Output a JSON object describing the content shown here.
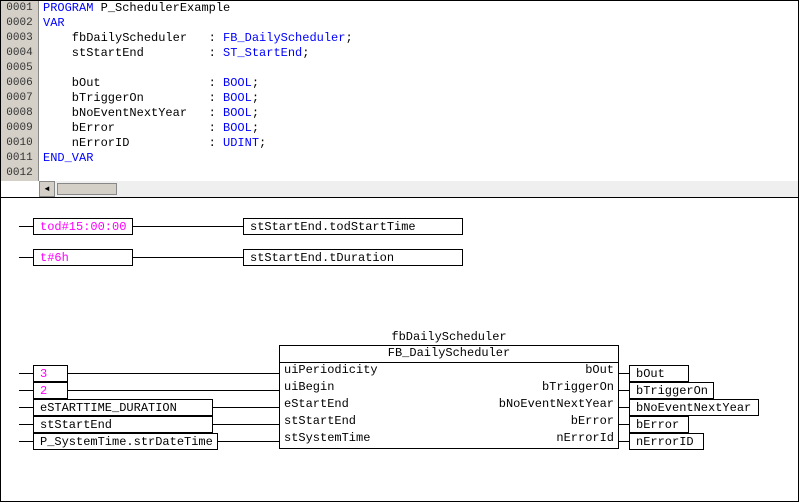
{
  "code": {
    "lines": [
      {
        "n": "0001",
        "pre": "",
        "kw": "PROGRAM",
        "rest": " P_SchedulerExample"
      },
      {
        "n": "0002",
        "pre": "",
        "kw": "VAR",
        "rest": ""
      },
      {
        "n": "0003",
        "pre": "    ",
        "name": "fbDailyScheduler",
        "colpad": "   ",
        "type": "FB_DailyScheduler"
      },
      {
        "n": "0004",
        "pre": "    ",
        "name": "stStartEnd",
        "colpad": "         ",
        "type": "ST_StartEnd"
      },
      {
        "n": "0005",
        "blank": true
      },
      {
        "n": "0006",
        "pre": "    ",
        "name": "bOut",
        "colpad": "               ",
        "type": "BOOL"
      },
      {
        "n": "0007",
        "pre": "    ",
        "name": "bTriggerOn",
        "colpad": "         ",
        "type": "BOOL"
      },
      {
        "n": "0008",
        "pre": "    ",
        "name": "bNoEventNextYear",
        "colpad": "   ",
        "type": "BOOL"
      },
      {
        "n": "0009",
        "pre": "    ",
        "name": "bError",
        "colpad": "             ",
        "type": "BOOL"
      },
      {
        "n": "0010",
        "pre": "    ",
        "name": "nErrorID",
        "colpad": "           ",
        "type": "UDINT"
      },
      {
        "n": "0011",
        "pre": "",
        "kw": "END_VAR",
        "rest": ""
      },
      {
        "n": "0012",
        "blank": true
      }
    ]
  },
  "assign": [
    {
      "lit": "tod#15:00:00",
      "target": "stStartEnd.todStartTime",
      "lw": 100,
      "ww": 110,
      "tw": 220
    },
    {
      "lit": "t#6h",
      "target": "stStartEnd.tDuration",
      "lw": 100,
      "ww": 110,
      "tw": 220
    }
  ],
  "fb": {
    "instance": "fbDailyScheduler",
    "type": "FB_DailyScheduler",
    "inputs": [
      "uiPeriodicity",
      "uiBegin",
      "eStartEnd",
      "stStartEnd",
      "stSystemTime"
    ],
    "outputs": [
      "bOut",
      "bTriggerOn",
      "bNoEventNextYear",
      "bError",
      "nErrorId"
    ],
    "leftvals": [
      "3",
      "2",
      "eSTARTTIME_DURATION",
      "stStartEnd",
      "P_SystemTime.strDateTime"
    ],
    "leftw": [
      35,
      35,
      180,
      180,
      185
    ],
    "rightvals": [
      "bOut",
      "bTriggerOn",
      "bNoEventNextYear",
      "bError",
      "nErrorID"
    ],
    "rightw": [
      60,
      85,
      130,
      60,
      75
    ]
  }
}
